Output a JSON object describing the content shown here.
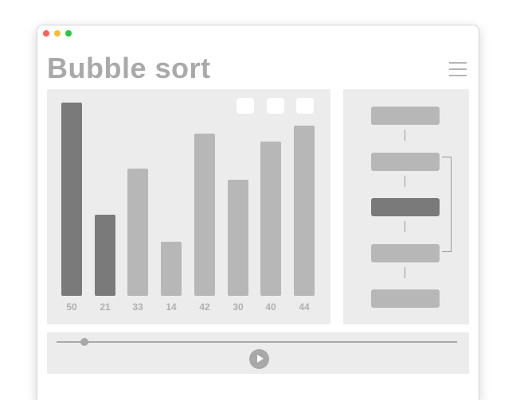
{
  "window": {
    "title": "Bubble sort"
  },
  "header": {
    "menu_icon": "hamburger-menu-icon"
  },
  "toolbar": {
    "buttons": [
      "blank-button",
      "blank-button",
      "blank-button"
    ]
  },
  "colors": {
    "bar_active": "#7a7a7a",
    "bar_inactive": "#b7b7b7",
    "panel": "#ececec",
    "title": "#a9a9a9"
  },
  "chart_data": {
    "type": "bar",
    "categories": [
      "50",
      "21",
      "33",
      "14",
      "42",
      "30",
      "40",
      "44"
    ],
    "values": [
      50,
      21,
      33,
      14,
      42,
      30,
      40,
      44
    ],
    "highlighted": [
      true,
      true,
      false,
      false,
      false,
      false,
      false,
      false
    ],
    "title": "",
    "xlabel": "",
    "ylabel": ""
  },
  "steps": {
    "count": 5,
    "active_index": 2
  },
  "playback": {
    "progress": 0.05,
    "play_icon": "play-icon"
  }
}
